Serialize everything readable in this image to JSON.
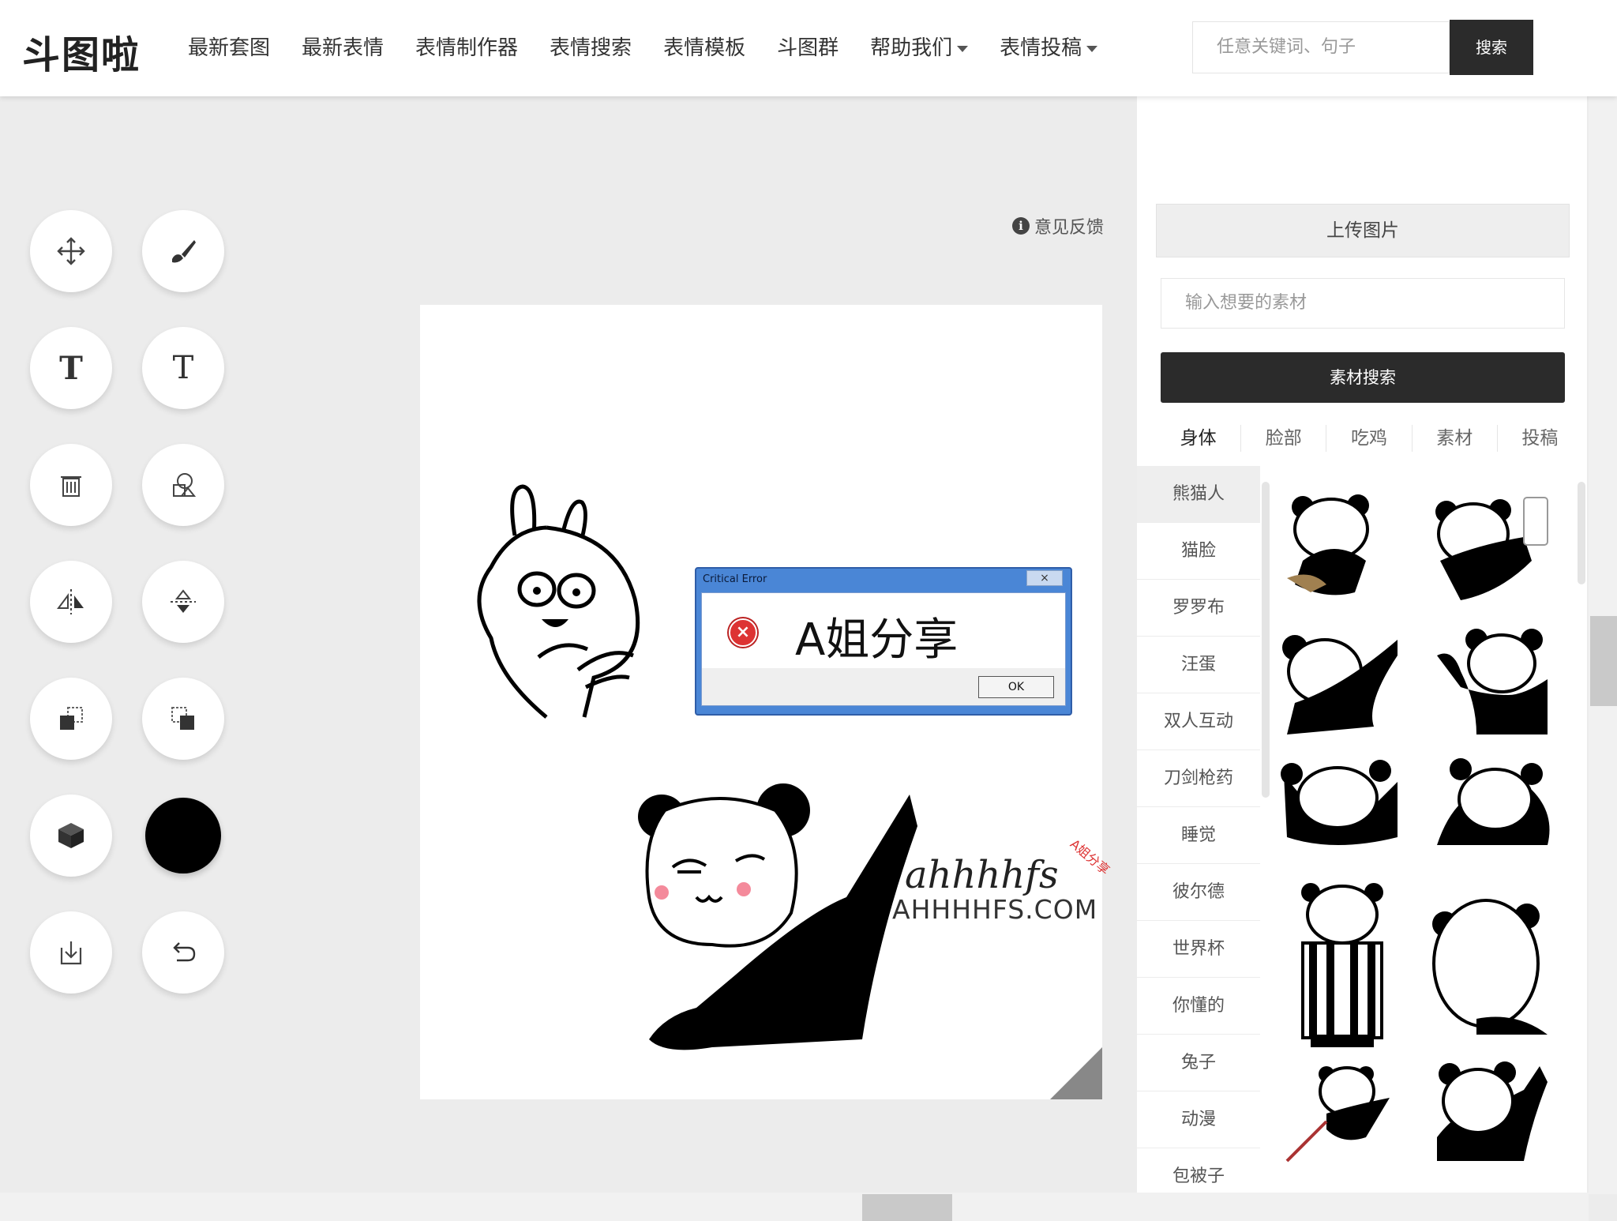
{
  "header": {
    "logo": "斗图啦",
    "nav": [
      {
        "label": "最新套图"
      },
      {
        "label": "最新表情"
      },
      {
        "label": "表情制作器"
      },
      {
        "label": "表情搜索"
      },
      {
        "label": "表情模板"
      },
      {
        "label": "斗图群"
      },
      {
        "label": "帮助我们",
        "dropdown": true
      },
      {
        "label": "表情投稿",
        "dropdown": true
      }
    ],
    "search_placeholder": "任意关键词、句子",
    "search_button": "搜索"
  },
  "toolbar": {
    "tools": [
      "move-icon",
      "brush-icon",
      "text-bold-icon",
      "text-size-icon",
      "trash-icon",
      "shapes-icon",
      "flip-horizontal-icon",
      "flip-vertical-icon",
      "send-backward-icon",
      "bring-forward-icon",
      "cube-icon",
      "color-picker",
      "download-icon",
      "undo-icon"
    ],
    "current_color": "#000000"
  },
  "feedback": "意见反馈",
  "canvas": {
    "dialog": {
      "title": "Critical Error",
      "close": "×",
      "message": "A姐分享",
      "ok": "OK"
    },
    "watermark": {
      "script": "ahhhhfs",
      "domain": "AHHHHFS.COM",
      "side": "A姐分享"
    }
  },
  "right_panel": {
    "upload_label": "上传图片",
    "material_placeholder": "输入想要的素材",
    "material_search": "素材搜索",
    "tabs": [
      "身体",
      "脸部",
      "吃鸡",
      "素材",
      "投稿"
    ],
    "active_tab": "身体",
    "categories": [
      "熊猫人",
      "猫脸",
      "罗罗布",
      "汪蛋",
      "双人互动",
      "刀剑枪药",
      "睡觉",
      "彼尔德",
      "世界杯",
      "你懂的",
      "兔子",
      "动漫",
      "包被子"
    ],
    "active_category": "熊猫人"
  }
}
